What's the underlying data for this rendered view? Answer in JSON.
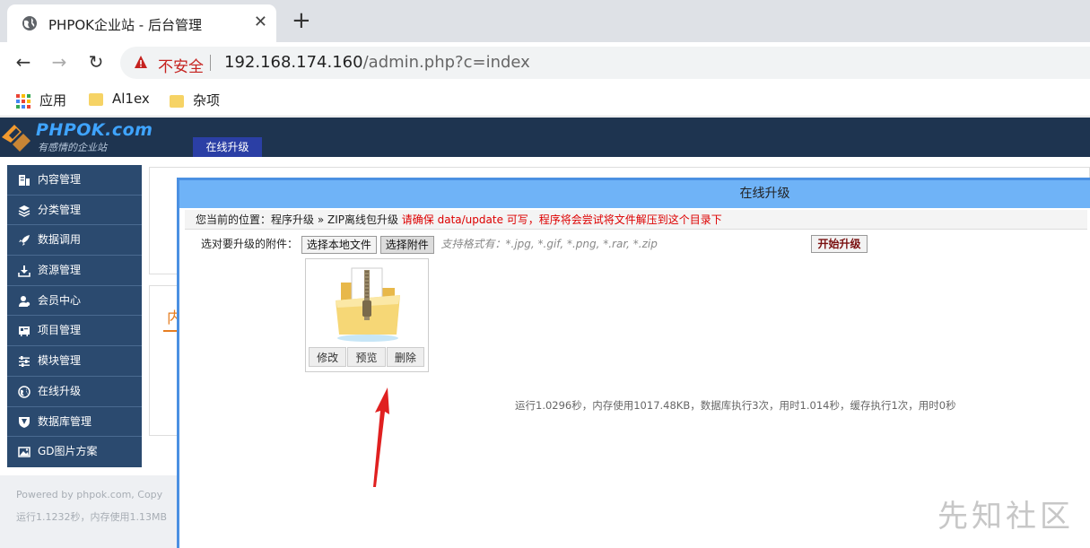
{
  "browser": {
    "tab_title": "PHPOK企业站 - 后台管理",
    "new_tab": "+",
    "security_label": "不安全",
    "url_host": "192.168.174.160",
    "url_path": "/admin.php?c=index",
    "bookmarks": [
      {
        "label": "应用",
        "icon": "apps-icon"
      },
      {
        "label": "Al1ex",
        "icon": "folder-icon"
      },
      {
        "label": "杂项",
        "icon": "folder-icon"
      }
    ]
  },
  "header": {
    "logo": "PHPOK.com",
    "slogan": "有感情的企业站",
    "active_tab": "在线升级"
  },
  "sidebar": {
    "items": [
      {
        "label": "内容管理"
      },
      {
        "label": "分类管理"
      },
      {
        "label": "数据调用"
      },
      {
        "label": "资源管理"
      },
      {
        "label": "会员中心"
      },
      {
        "label": "项目管理"
      },
      {
        "label": "模块管理"
      },
      {
        "label": "在线升级"
      },
      {
        "label": "数据库管理"
      },
      {
        "label": "GD图片方案"
      }
    ]
  },
  "background": {
    "tab_char": "内",
    "footer_line1": "Powered by phpok.com, Copy",
    "footer_line2": "运行1.1232秒，内存使用1.13MB"
  },
  "modal": {
    "title": "在线升级",
    "breadcrumb_text": "您当前的位置：程序升级 » ZIP离线包升级",
    "breadcrumb_warning": "请确保 data/update 可写，程序将会尝试将文件解压到这个目录下",
    "upload_label": "选对要升级的附件：",
    "choose_local": "选择本地文件",
    "choose_attachment": "选择附件",
    "formats": "支持格式有：*.jpg, *.gif, *.png, *.rar, *.zip",
    "start_button": "开始升级",
    "card_actions": [
      "修改",
      "预览",
      "删除"
    ],
    "runtime": "运行1.0296秒，内存使用1017.48KB，数据库执行3次，用时1.014秒，缓存执行1次，用时0秒"
  },
  "watermark": "先知社区",
  "colors": {
    "header_bg": "#1e3450",
    "sidebar_bg": "#2b4a6f",
    "modal_title_bg": "#6fb3f7",
    "insecure": "#c5221f",
    "arrow": "#e02020"
  }
}
